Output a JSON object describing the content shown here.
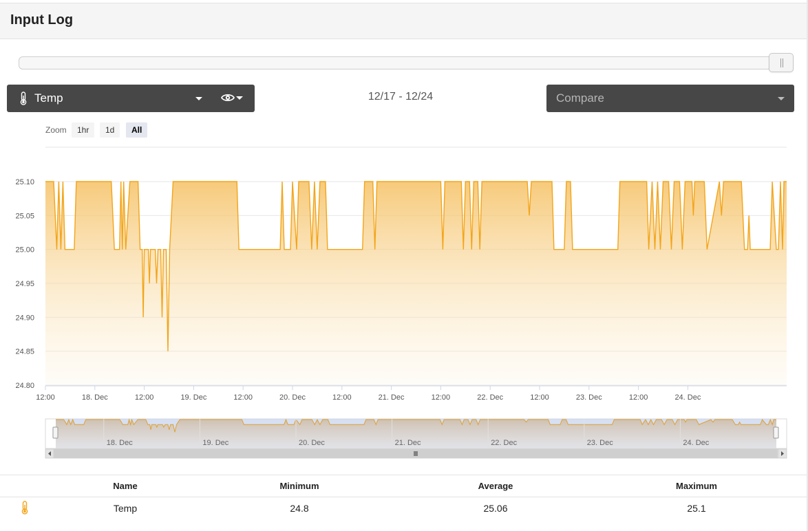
{
  "page": {
    "title": "Input Log"
  },
  "sensor_select": {
    "label": "Temp",
    "icon": "thermometer-icon",
    "visibility_icon": "eye-icon"
  },
  "date_range": "12/17 - 12/24",
  "compare_select": {
    "placeholder": "Compare"
  },
  "zoom": {
    "label": "Zoom",
    "buttons": [
      "1hr",
      "1d",
      "All"
    ],
    "active": "All"
  },
  "colors": {
    "series": "#f2a51a",
    "fill": "#f7cc78",
    "navigator_fill": "#d6cdc4",
    "navigator_mask": "#c9d6ee",
    "dark_select": "#474747"
  },
  "chart_data": {
    "type": "area",
    "series": [
      {
        "name": "Temp",
        "points": [
          [
            "2021-12-17 12:00",
            25.1
          ],
          [
            "2021-12-17 14:00",
            25.1
          ],
          [
            "2021-12-17 14:45",
            25.0
          ],
          [
            "2021-12-17 15:15",
            25.1
          ],
          [
            "2021-12-17 15:45",
            25.0
          ],
          [
            "2021-12-17 16:15",
            25.1
          ],
          [
            "2021-12-17 16:45",
            25.0
          ],
          [
            "2021-12-17 19:00",
            25.0
          ],
          [
            "2021-12-17 19:30",
            25.1
          ],
          [
            "2021-12-18 04:00",
            25.1
          ],
          [
            "2021-12-18 04:45",
            25.0
          ],
          [
            "2021-12-18 06:00",
            25.0
          ],
          [
            "2021-12-18 06:20",
            25.1
          ],
          [
            "2021-12-18 06:40",
            25.0
          ],
          [
            "2021-12-18 07:00",
            25.1
          ],
          [
            "2021-12-18 07:30",
            25.0
          ],
          [
            "2021-12-18 08:30",
            25.1
          ],
          [
            "2021-12-18 10:30",
            25.1
          ],
          [
            "2021-12-18 11:00",
            25.0
          ],
          [
            "2021-12-18 11:30",
            25.0
          ],
          [
            "2021-12-18 11:45",
            24.9
          ],
          [
            "2021-12-18 12:00",
            25.0
          ],
          [
            "2021-12-18 13:00",
            25.0
          ],
          [
            "2021-12-18 13:15",
            24.95
          ],
          [
            "2021-12-18 13:30",
            25.0
          ],
          [
            "2021-12-18 14:40",
            25.0
          ],
          [
            "2021-12-18 15:00",
            24.95
          ],
          [
            "2021-12-18 15:20",
            25.0
          ],
          [
            "2021-12-18 16:00",
            25.0
          ],
          [
            "2021-12-18 16:20",
            24.9
          ],
          [
            "2021-12-18 16:40",
            25.0
          ],
          [
            "2021-12-18 17:20",
            25.0
          ],
          [
            "2021-12-18 17:45",
            24.85
          ],
          [
            "2021-12-18 18:10",
            25.0
          ],
          [
            "2021-12-18 19:00",
            25.1
          ],
          [
            "2021-12-19 10:30",
            25.1
          ],
          [
            "2021-12-19 11:00",
            25.0
          ],
          [
            "2021-12-19 21:00",
            25.0
          ],
          [
            "2021-12-19 21:30",
            25.1
          ],
          [
            "2021-12-19 22:00",
            25.0
          ],
          [
            "2021-12-19 23:30",
            25.0
          ],
          [
            "2021-12-20 00:00",
            25.1
          ],
          [
            "2021-12-20 01:00",
            25.0
          ],
          [
            "2021-12-20 01:30",
            25.1
          ],
          [
            "2021-12-20 04:00",
            25.1
          ],
          [
            "2021-12-20 04:40",
            25.0
          ],
          [
            "2021-12-20 05:20",
            25.1
          ],
          [
            "2021-12-20 06:00",
            25.0
          ],
          [
            "2021-12-20 06:40",
            25.1
          ],
          [
            "2021-12-20 08:00",
            25.1
          ],
          [
            "2021-12-20 08:30",
            25.0
          ],
          [
            "2021-12-20 17:00",
            25.0
          ],
          [
            "2021-12-20 17:30",
            25.1
          ],
          [
            "2021-12-20 19:30",
            25.1
          ],
          [
            "2021-12-20 20:00",
            25.0
          ],
          [
            "2021-12-20 20:30",
            25.1
          ],
          [
            "2021-12-21 12:00",
            25.1
          ],
          [
            "2021-12-21 12:30",
            25.0
          ],
          [
            "2021-12-21 13:00",
            25.1
          ],
          [
            "2021-12-21 17:00",
            25.1
          ],
          [
            "2021-12-21 17:30",
            25.0
          ],
          [
            "2021-12-21 18:00",
            25.1
          ],
          [
            "2021-12-21 19:00",
            25.1
          ],
          [
            "2021-12-21 19:30",
            25.0
          ],
          [
            "2021-12-21 20:00",
            25.1
          ],
          [
            "2021-12-21 21:00",
            25.1
          ],
          [
            "2021-12-21 21:30",
            25.0
          ],
          [
            "2021-12-21 22:00",
            25.1
          ],
          [
            "2021-12-22 09:00",
            25.1
          ],
          [
            "2021-12-22 09:30",
            25.05
          ],
          [
            "2021-12-22 10:00",
            25.1
          ],
          [
            "2021-12-22 15:00",
            25.1
          ],
          [
            "2021-12-22 15:30",
            25.0
          ],
          [
            "2021-12-22 18:00",
            25.0
          ],
          [
            "2021-12-22 18:30",
            25.1
          ],
          [
            "2021-12-22 19:30",
            25.1
          ],
          [
            "2021-12-22 20:00",
            25.0
          ],
          [
            "2021-12-23 07:00",
            25.0
          ],
          [
            "2021-12-23 07:30",
            25.1
          ],
          [
            "2021-12-23 14:00",
            25.1
          ],
          [
            "2021-12-23 14:30",
            25.0
          ],
          [
            "2021-12-23 15:20",
            25.1
          ],
          [
            "2021-12-23 16:00",
            25.0
          ],
          [
            "2021-12-23 16:40",
            25.1
          ],
          [
            "2021-12-23 17:20",
            25.0
          ],
          [
            "2021-12-23 18:00",
            25.1
          ],
          [
            "2021-12-23 19:20",
            25.1
          ],
          [
            "2021-12-23 20:00",
            25.0
          ],
          [
            "2021-12-23 20:40",
            25.1
          ],
          [
            "2021-12-23 22:00",
            25.1
          ],
          [
            "2021-12-23 22:40",
            25.0
          ],
          [
            "2021-12-23 23:20",
            25.1
          ],
          [
            "2021-12-24 01:00",
            25.1
          ],
          [
            "2021-12-24 01:20",
            25.05
          ],
          [
            "2021-12-24 01:40",
            25.1
          ],
          [
            "2021-12-24 04:00",
            25.1
          ],
          [
            "2021-12-24 04:40",
            25.0
          ],
          [
            "2021-12-24 07:40",
            25.1
          ],
          [
            "2021-12-24 08:10",
            25.05
          ],
          [
            "2021-12-24 08:40",
            25.1
          ],
          [
            "2021-12-24 13:00",
            25.1
          ],
          [
            "2021-12-24 13:45",
            25.0
          ],
          [
            "2021-12-24 14:30",
            25.0
          ],
          [
            "2021-12-24 14:50",
            25.05
          ],
          [
            "2021-12-24 15:10",
            25.0
          ],
          [
            "2021-12-24 20:00",
            25.0
          ],
          [
            "2021-12-24 20:30",
            25.1
          ],
          [
            "2021-12-24 21:30",
            25.0
          ],
          [
            "2021-12-24 22:00",
            25.0
          ],
          [
            "2021-12-24 22:30",
            25.1
          ],
          [
            "2021-12-24 23:00",
            25.0
          ],
          [
            "2021-12-24 23:20",
            25.1
          ],
          [
            "2021-12-25 00:00",
            25.1
          ]
        ]
      }
    ],
    "y_ticks": [
      "25.10",
      "25.05",
      "25.00",
      "24.95",
      "24.90",
      "24.85",
      "24.80"
    ],
    "ylim": [
      24.8,
      25.1
    ],
    "x_ticks": [
      "12:00",
      "18. Dec",
      "12:00",
      "19. Dec",
      "12:00",
      "20. Dec",
      "12:00",
      "21. Dec",
      "12:00",
      "22. Dec",
      "12:00",
      "23. Dec",
      "12:00",
      "24. Dec"
    ],
    "x_tick_times": [
      "2021-12-17 12:00",
      "2021-12-18 00:00",
      "2021-12-18 12:00",
      "2021-12-19 00:00",
      "2021-12-19 12:00",
      "2021-12-20 00:00",
      "2021-12-20 12:00",
      "2021-12-21 00:00",
      "2021-12-21 12:00",
      "2021-12-22 00:00",
      "2021-12-22 12:00",
      "2021-12-23 00:00",
      "2021-12-23 12:00",
      "2021-12-24 00:00"
    ],
    "xlim": [
      "2021-12-17 12:00",
      "2021-12-25 00:00"
    ],
    "navigator_ticks": [
      "18. Dec",
      "19. Dec",
      "20. Dec",
      "21. Dec",
      "22. Dec",
      "23. Dec",
      "24. Dec"
    ],
    "grid": true,
    "legend": "none"
  },
  "stats_table": {
    "columns": [
      "Name",
      "Minimum",
      "Average",
      "Maximum"
    ],
    "rows": [
      {
        "icon": "thermometer-icon",
        "name": "Temp",
        "minimum": "24.8",
        "average": "25.06",
        "maximum": "25.1"
      }
    ]
  }
}
